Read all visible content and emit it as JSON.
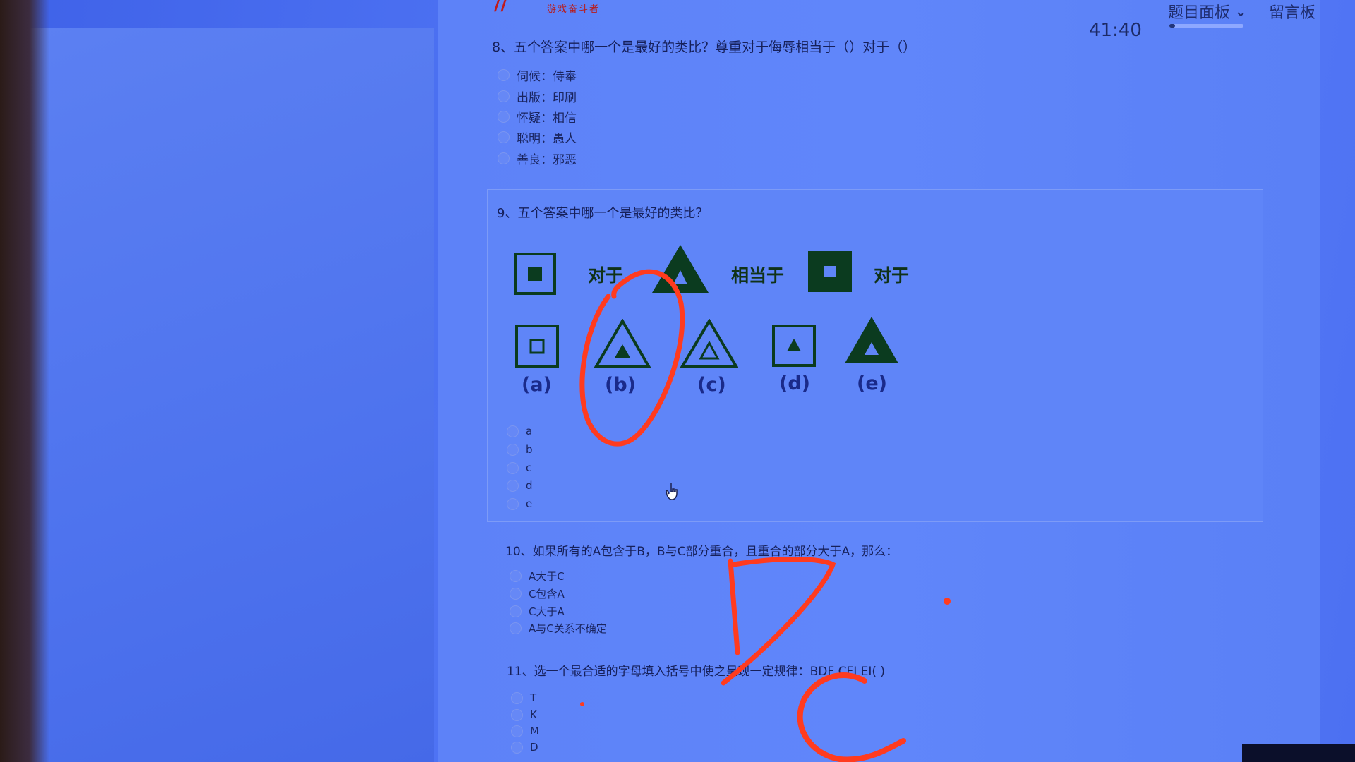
{
  "header": {
    "logo_subtitle": "游戏奋斗者",
    "timer": "41:40",
    "question_panel_label": "题目面板",
    "message_board_label": "留言板",
    "progress_fraction": 0.08
  },
  "questions": [
    {
      "number": "8",
      "title": "8、五个答案中哪一个是最好的类比？尊重对于侮辱相当于（）对于（）",
      "options": [
        "伺候：侍奉",
        "出版：印刷",
        "怀疑：相信",
        "聪明：愚人",
        "善良：邪恶"
      ]
    },
    {
      "number": "9",
      "title": "9、五个答案中哪一个是最好的类比？",
      "figure": {
        "word_duiyu_1": "对于",
        "word_xiangdangyu": "相当于",
        "word_duiyu_2": "对于",
        "choice_labels": [
          "(a)",
          "(b)",
          "(c)",
          "(d)",
          "(e)"
        ]
      },
      "options": [
        "a",
        "b",
        "c",
        "d",
        "e"
      ]
    },
    {
      "number": "10",
      "title": "10、如果所有的A包含于B，B与C部分重合，且重合的部分大于A，那么：",
      "options": [
        "A大于C",
        "C包含A",
        "C大于A",
        "A与C关系不确定"
      ]
    },
    {
      "number": "11",
      "title": "11、选一个最合适的字母填入括号中使之呈现一定规律：BDF CFI EI( )",
      "options": [
        "T",
        "K",
        "M",
        "D"
      ]
    }
  ],
  "annotations": {
    "handwritten_answer_q10": "D",
    "handwritten_answer_q11": "C",
    "annotation_color": "#ff3b1f"
  }
}
